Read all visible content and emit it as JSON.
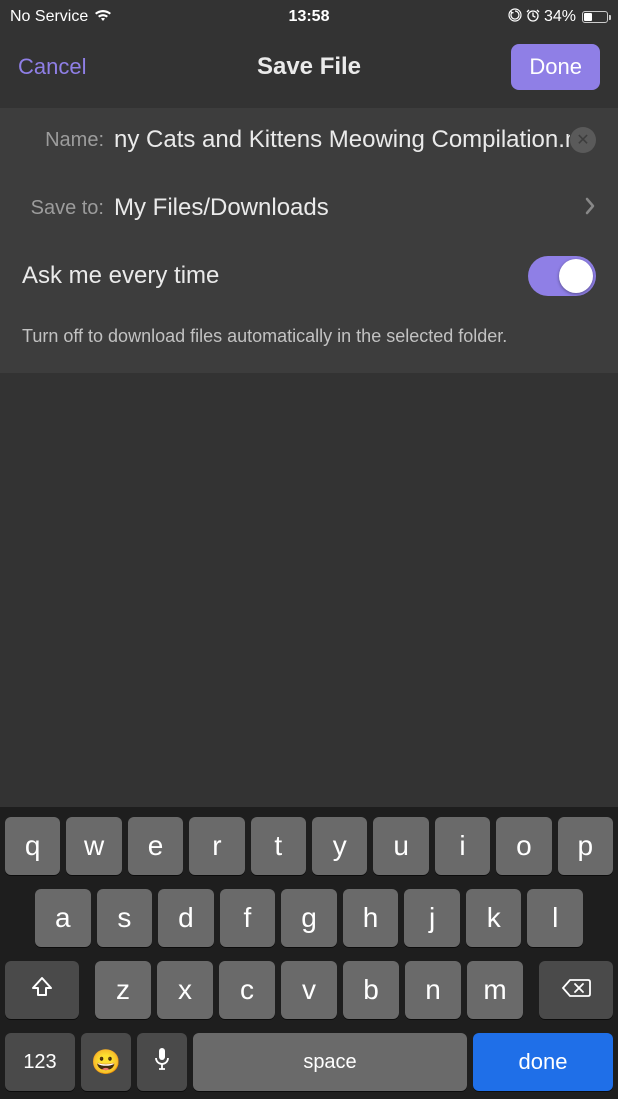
{
  "status": {
    "carrier": "No Service",
    "time": "13:58",
    "battery_percent": "34%"
  },
  "nav": {
    "cancel": "Cancel",
    "title": "Save File",
    "done": "Done"
  },
  "form": {
    "name_label": "Name:",
    "name_value": "ny Cats and Kittens Meowing Compilation.m",
    "saveto_label": "Save to:",
    "saveto_value": "My Files/Downloads",
    "ask_label": "Ask me every time",
    "ask_on": true,
    "hint": "Turn off to download files automatically in the selected folder."
  },
  "keyboard": {
    "row1": [
      "q",
      "w",
      "e",
      "r",
      "t",
      "y",
      "u",
      "i",
      "o",
      "p"
    ],
    "row2": [
      "a",
      "s",
      "d",
      "f",
      "g",
      "h",
      "j",
      "k",
      "l"
    ],
    "row3": [
      "z",
      "x",
      "c",
      "v",
      "b",
      "n",
      "m"
    ],
    "numkey": "123",
    "space": "space",
    "done": "done"
  }
}
